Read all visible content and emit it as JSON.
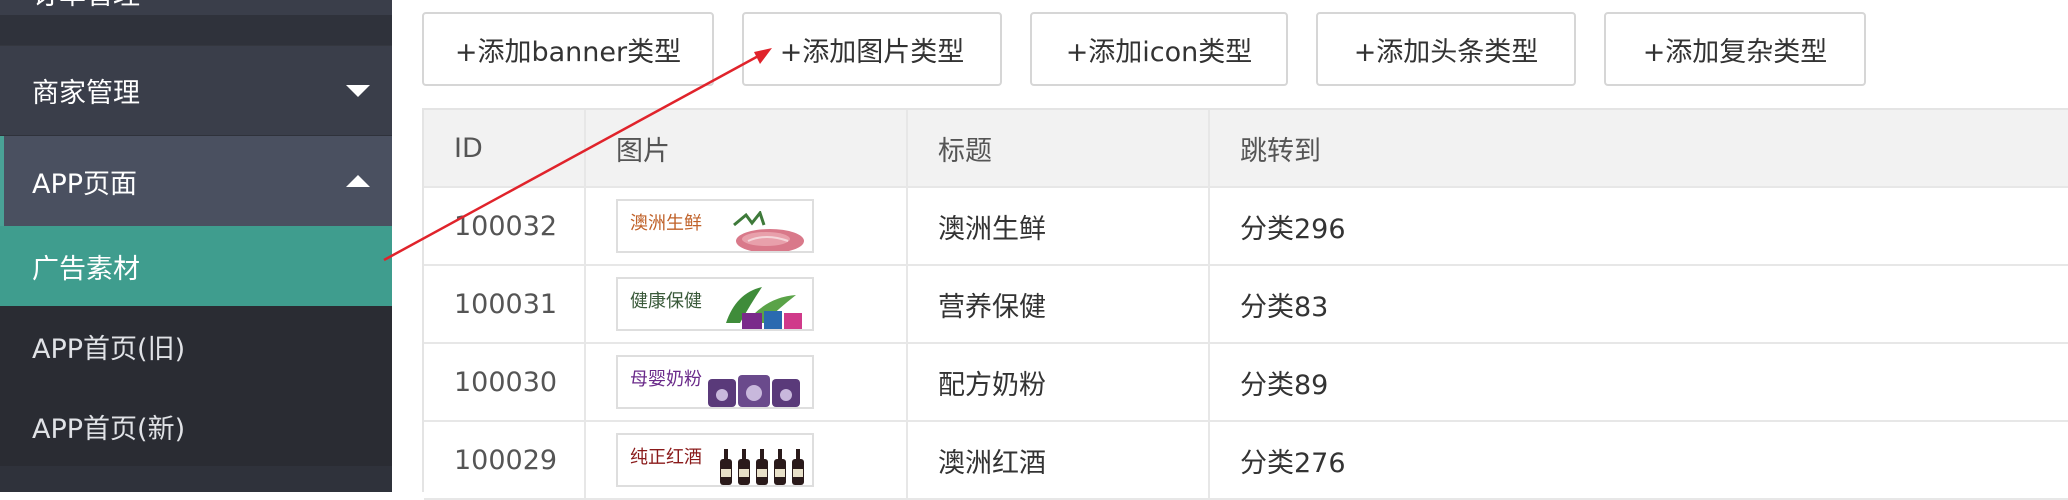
{
  "sidebar": {
    "items": [
      {
        "label": "订单管理"
      },
      {
        "label": "商家管理"
      },
      {
        "label": "APP页面"
      },
      {
        "label": "广告素材"
      },
      {
        "label": "APP首页(旧)"
      },
      {
        "label": "APP首页(新)"
      }
    ],
    "active_color": "#3f9d8e"
  },
  "toolbar": {
    "add_banner": "+添加banner类型",
    "add_image": "+添加图片类型",
    "add_icon": "+添加icon类型",
    "add_headline": "+添加头条类型",
    "add_complex": "+添加复杂类型"
  },
  "table": {
    "columns": [
      "ID",
      "图片",
      "标题",
      "跳转到"
    ],
    "rows": [
      {
        "id": "100032",
        "thumb_label": "澳洲生鲜",
        "thumb_label_color": "#c0622a",
        "thumb_icon": "steak-icon",
        "title": "澳洲生鲜",
        "link": "分类296"
      },
      {
        "id": "100031",
        "thumb_label": "健康保健",
        "thumb_label_color": "#3a5a3a",
        "thumb_icon": "supplements-icon",
        "title": "营养保健",
        "link": "分类83"
      },
      {
        "id": "100030",
        "thumb_label": "母婴奶粉",
        "thumb_label_color": "#6a2a8a",
        "thumb_icon": "formula-cans-icon",
        "title": "配方奶粉",
        "link": "分类89"
      },
      {
        "id": "100029",
        "thumb_label": "纯正红酒",
        "thumb_label_color": "#8a1a1a",
        "thumb_icon": "wine-bottles-icon",
        "title": "澳洲红酒",
        "link": "分类276"
      }
    ]
  },
  "annotation": {
    "arrow_color": "#e0232b"
  }
}
